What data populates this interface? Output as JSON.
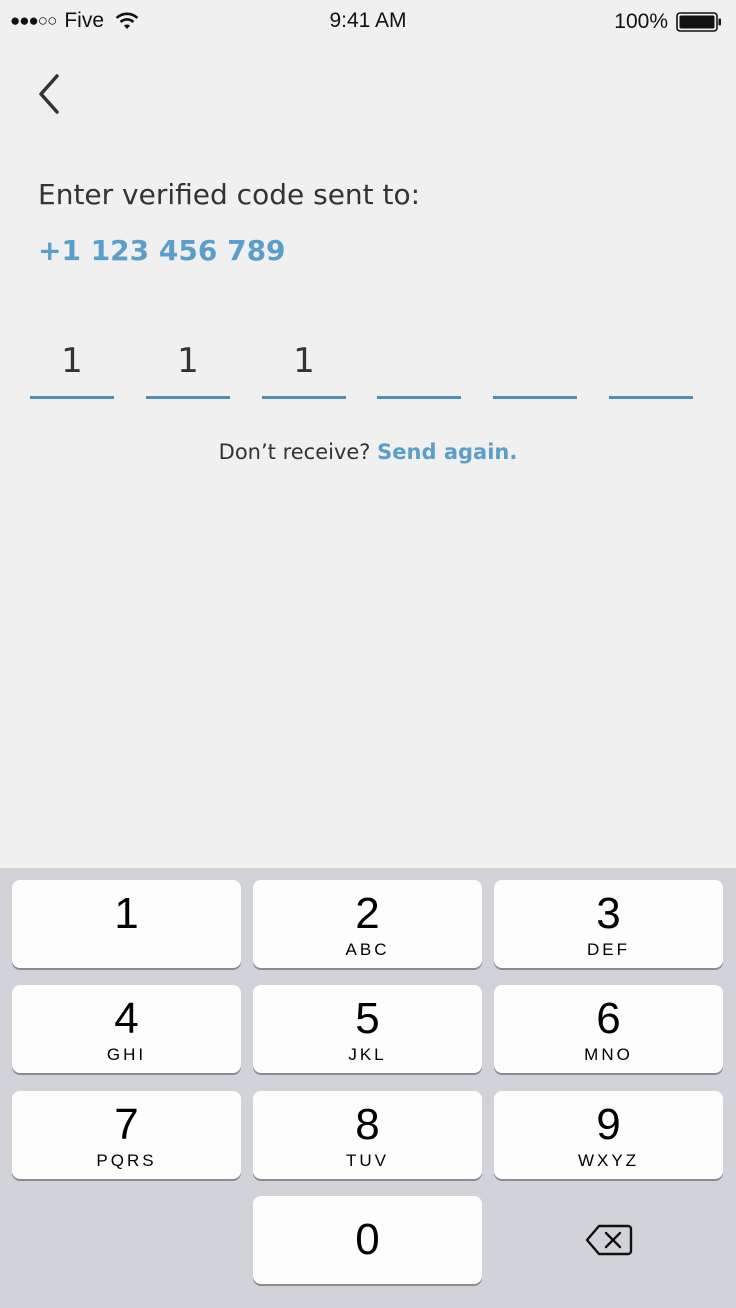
{
  "status_bar": {
    "signal_dots": "●●●○○",
    "carrier": "Five",
    "time": "9:41 AM",
    "battery_percent": "100%",
    "wifi_icon": "wifi-icon",
    "battery_icon": "battery-icon"
  },
  "nav": {
    "back_icon": "chevron-left-icon"
  },
  "verification": {
    "prompt": "Enter verified code sent to:",
    "phone": "+1 123 456 789",
    "code_digits": [
      "1",
      "1",
      "1",
      "",
      "",
      ""
    ],
    "resend_text": "Don’t receive?",
    "resend_link": "Send again."
  },
  "keypad": {
    "keys": [
      {
        "digit": "1",
        "letters": ""
      },
      {
        "digit": "2",
        "letters": "ABC"
      },
      {
        "digit": "3",
        "letters": "DEF"
      },
      {
        "digit": "4",
        "letters": "GHI"
      },
      {
        "digit": "5",
        "letters": "JKL"
      },
      {
        "digit": "6",
        "letters": "MNO"
      },
      {
        "digit": "7",
        "letters": "PQRS"
      },
      {
        "digit": "8",
        "letters": "TUV"
      },
      {
        "digit": "9",
        "letters": "WXYZ"
      },
      {
        "digit": "0",
        "letters": ""
      }
    ],
    "delete_icon": "backspace-icon"
  },
  "colors": {
    "accent": "#5a9fca",
    "underline": "#4f8fb7",
    "background": "#f0f0f0",
    "keypad_background": "#d1d3d8"
  }
}
